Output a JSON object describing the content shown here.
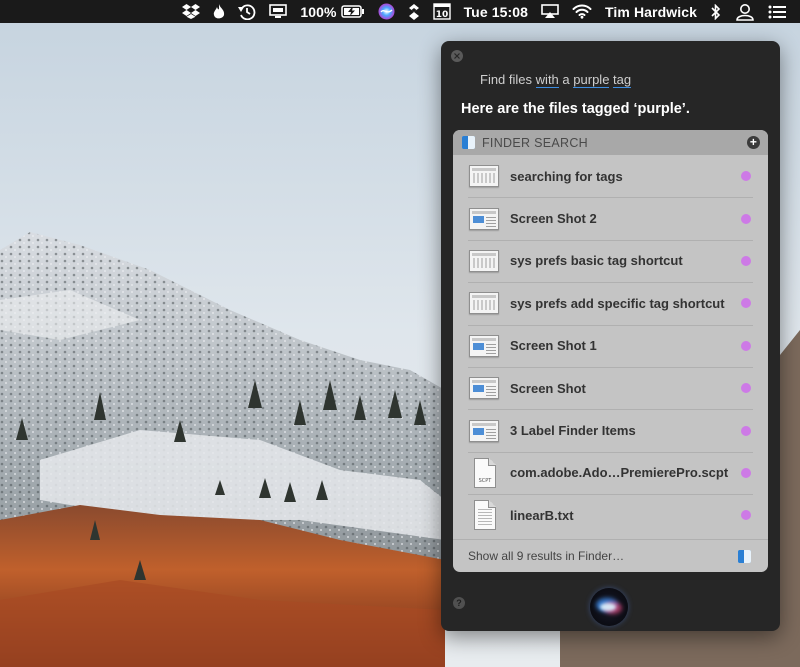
{
  "menubar": {
    "battery_percent": "100%",
    "calendar_day": "10",
    "clock": "Tue 15:08",
    "user_name": "Tim Hardwick"
  },
  "siri": {
    "query_words": [
      "Find",
      "files",
      "with",
      "a",
      "purple",
      "tag"
    ],
    "response": "Here are the files tagged ‘purple’.",
    "card_title": "FINDER SEARCH",
    "results": [
      {
        "label": "searching for tags",
        "icon": "screenshot-thumbnail",
        "tag_color": "#cd7ae6"
      },
      {
        "label": "Screen Shot 2",
        "icon": "screenshot-thumbnail",
        "tag_color": "#cd7ae6"
      },
      {
        "label": "sys prefs basic tag shortcut",
        "icon": "screenshot-thumbnail",
        "tag_color": "#cd7ae6"
      },
      {
        "label": "sys prefs add specific tag shortcut",
        "icon": "screenshot-thumbnail",
        "tag_color": "#cd7ae6"
      },
      {
        "label": "Screen Shot 1",
        "icon": "screenshot-thumbnail",
        "tag_color": "#cd7ae6"
      },
      {
        "label": "Screen Shot",
        "icon": "screenshot-thumbnail",
        "tag_color": "#cd7ae6"
      },
      {
        "label": "3 Label Finder Items",
        "icon": "screenshot-thumbnail",
        "tag_color": "#cd7ae6"
      },
      {
        "label": "com.adobe.Ado…PremierePro.scpt",
        "icon": "script-document",
        "icon_text": "SCPT",
        "tag_color": "#cd7ae6"
      },
      {
        "label": "linearB.txt",
        "icon": "text-document",
        "tag_color": "#cd7ae6"
      }
    ],
    "footer_link": "Show all 9 results in Finder…"
  },
  "colors": {
    "menubar_bg": "#1a1a1a",
    "panel_bg": "#262626",
    "card_bg": "#c4c4c4",
    "purple_tag": "#cd7ae6",
    "query_underline": "#3d8de0"
  }
}
